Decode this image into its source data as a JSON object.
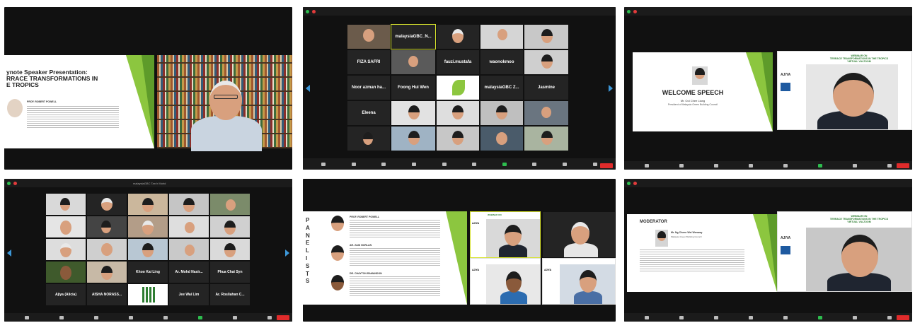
{
  "panel1": {
    "slide_title_line1": "ynote Speaker Presentation:",
    "slide_title_line2": "RRACE TRANSFORMATIONS IN",
    "slide_title_line3": "E TROPICS",
    "speaker_label": "PROF. ROBERT POWELL"
  },
  "panel2": {
    "participants": [
      "malaysiaGBC_N...",
      "FIZA SAFRI",
      "fauzi.mustafa",
      "waonokmoo",
      "Noor azman ha...",
      "Foong Hui Wen",
      "malaysiaGBC Z...",
      "Jasmine",
      "Eleena"
    ]
  },
  "panel3": {
    "slide_heading": "WELCOME SPEECH",
    "speaker_name": "Mr. Ooi Chee Liang",
    "speaker_role": "President of Malaysia Green Building Council",
    "webinar_title_line1": "WEBINAR ON",
    "webinar_title_line2": "TERRACE TRANSFORMATIONS IN THE TROPICS",
    "webinar_title_line3": "VIRTUAL VIA ZOOM",
    "logo_text": "AJIYA"
  },
  "panel4": {
    "window_title": "malaysiaGBC Tan h Mohd",
    "participants": [
      "Khoo Kai Ling",
      "Ar. Mohd Nasir...",
      "Phua Chai Syn",
      "Ajiya (Alicia)",
      "AISHA NORASS...",
      "Jee Wai Lim",
      "Ar. Rosliahan C..."
    ]
  },
  "panel5": {
    "panelists_vertical": "PANELISTS",
    "panelist1": "PROF. ROBERT POWELL",
    "panelist2": "AR. ZAID NORLAN",
    "panelist3": "DR. CHAYTON RAMANDON",
    "webinar_label": "WEBINAR ON",
    "logo_text": "AJIYA"
  },
  "panel6": {
    "slide_heading": "MODERATOR",
    "moderator_name": "Mr. Ng Cheen Wei Wenway",
    "moderator_role": "Malaysia Green Building Council",
    "webinar_title_line1": "WEBINAR ON",
    "webinar_title_line2": "TERRACE TRANSFORMATIONS IN THE TROPICS",
    "webinar_title_line3": "VIRTUAL VIA ZOOM",
    "logo_text": "AJIYA"
  },
  "colors": {
    "zoom_dark": "#1b1b1b",
    "accent_green": "#8cc63f",
    "speaker_highlight": "#d7e32c",
    "nav_arrow": "#3d98d9",
    "end_button": "#e02b2b"
  }
}
